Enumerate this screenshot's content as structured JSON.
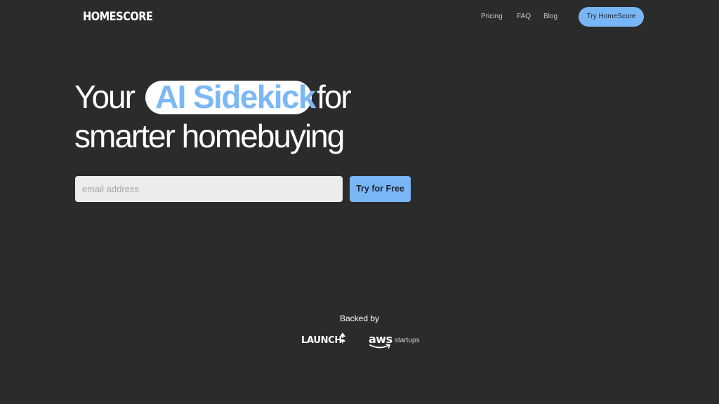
{
  "header": {
    "logo_text": "HOMESCORE",
    "nav": {
      "pricing": "Pricing",
      "faq": "FAQ",
      "blog": "Blog"
    },
    "cta_label": "Try HomeScore"
  },
  "hero": {
    "word_your": "Your",
    "highlight": "AI Sidekick",
    "word_for": "for",
    "line2": "smarter homebuying"
  },
  "signup": {
    "email_placeholder": "email address",
    "email_value": "",
    "button_label": "Try for Free"
  },
  "backers": {
    "heading": "Backed by",
    "launch_name": "LAUNCH",
    "aws_name": "aws",
    "aws_suffix": "startups"
  },
  "colors": {
    "background": "#2b2b2c",
    "accent": "#79b6f6",
    "text": "#ffffff",
    "input_bg": "#ececec"
  },
  "icons": {
    "launch_mark": "rocket-icon",
    "aws_mark": "aws-smile-icon"
  }
}
